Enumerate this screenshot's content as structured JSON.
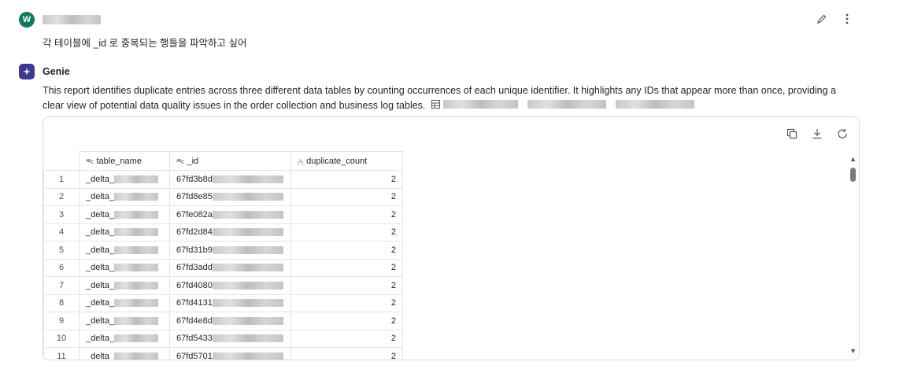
{
  "user": {
    "avatar_letter": "W",
    "message": "각 테이블에 _id 로 중복되는 행들을 파악하고 싶어"
  },
  "genie": {
    "name": "Genie",
    "summary": "This report identifies duplicate entries across three different data tables by counting occurrences of each unique identifier. It highlights any IDs that appear more than once, providing a clear view of potential data quality issues in the order collection and business log tables."
  },
  "toolbar": {
    "icons": [
      "copy-icon",
      "download-icon",
      "refresh-icon"
    ]
  },
  "table": {
    "columns": [
      {
        "type_glyph": "ᴬᴮc",
        "label": "table_name"
      },
      {
        "type_glyph": "ᴬᴮc",
        "label": "_id"
      },
      {
        "type_glyph": "₁²₃",
        "label": "duplicate_count"
      }
    ],
    "rows": [
      {
        "idx": "1",
        "name": "_delta_",
        "id": "67fd3b8d",
        "count": "2"
      },
      {
        "idx": "2",
        "name": "_delta_",
        "id": "67fd8e85",
        "count": "2"
      },
      {
        "idx": "3",
        "name": "_delta_",
        "id": "67fe082a",
        "count": "2"
      },
      {
        "idx": "4",
        "name": "_delta_",
        "id": "67fd2d84",
        "count": "2"
      },
      {
        "idx": "5",
        "name": "_delta_",
        "id": "67fd31b9",
        "count": "2"
      },
      {
        "idx": "6",
        "name": "_delta_",
        "id": "67fd3add",
        "count": "2"
      },
      {
        "idx": "7",
        "name": "_delta_",
        "id": "67fd4080",
        "count": "2"
      },
      {
        "idx": "8",
        "name": "_delta_",
        "id": "67fd4131",
        "count": "2"
      },
      {
        "idx": "9",
        "name": "_delta_",
        "id": "67fd4e8d",
        "count": "2"
      },
      {
        "idx": "10",
        "name": "_delta_",
        "id": "67fd5433",
        "count": "2"
      },
      {
        "idx": "11",
        "name": "_delta_",
        "id": "67fd5701",
        "count": "2"
      }
    ]
  },
  "colors": {
    "avatar": "#0f7a5f",
    "genie_badge": "#3b3a8f"
  }
}
